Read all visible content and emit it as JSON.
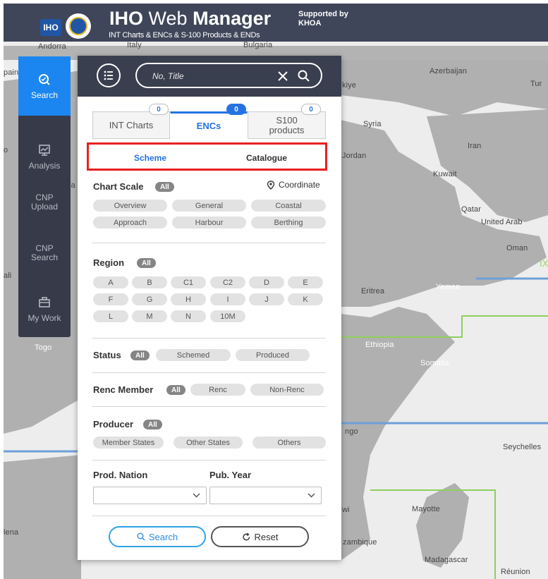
{
  "header": {
    "logo_text": "IHO",
    "title_bold": "IHO",
    "title_light": "Web",
    "title_bold2": "Manager",
    "subtitle": "INT Charts & ENCs & S-100 Products & ENDs",
    "supported_line1": "Supported by",
    "supported_line2": "KHOA"
  },
  "nav": {
    "items": [
      {
        "label": "Search",
        "icon": "search-icon",
        "active": true
      },
      {
        "label": "Analysis",
        "icon": "chart-icon",
        "active": false
      },
      {
        "label_line1": "CNP",
        "label_line2": "Upload"
      },
      {
        "label_line1": "CNP",
        "label_line2": "Search"
      },
      {
        "label": "My Work",
        "icon": "briefcase-icon",
        "active": false
      }
    ]
  },
  "search": {
    "placeholder": "No, Title",
    "value": ""
  },
  "tabs": [
    {
      "label": "INT Charts",
      "count": "0"
    },
    {
      "label": "ENCs",
      "count": "0",
      "active": true
    },
    {
      "label_line1": "S100",
      "label_line2": "products",
      "count": "0"
    }
  ],
  "subtabs": {
    "scheme": "Scheme",
    "catalogue": "Catalogue",
    "active": "Scheme"
  },
  "filters": {
    "chart_scale": {
      "title": "Chart Scale",
      "all": "All",
      "coordinate": "Coordinate",
      "options": [
        "Overview",
        "General",
        "Coastal",
        "Approach",
        "Harbour",
        "Berthing"
      ]
    },
    "region": {
      "title": "Region",
      "all": "All",
      "options": [
        "A",
        "B",
        "C1",
        "C2",
        "D",
        "E",
        "F",
        "G",
        "H",
        "I",
        "J",
        "K",
        "L",
        "M",
        "N",
        "10M"
      ]
    },
    "status": {
      "title": "Status",
      "all": "All",
      "options": [
        "Schemed",
        "Produced"
      ]
    },
    "renc_member": {
      "title": "Renc Member",
      "all": "All",
      "options": [
        "Renc",
        "Non-Renc"
      ]
    },
    "producer": {
      "title": "Producer",
      "all": "All",
      "options": [
        "Member States",
        "Other States",
        "Others"
      ]
    },
    "prod_nation": {
      "label": "Prod. Nation",
      "value": ""
    },
    "pub_year": {
      "label": "Pub. Year",
      "value": ""
    }
  },
  "buttons": {
    "search": "Search",
    "reset": "Reset"
  },
  "map_labels": {
    "andorra": "Andorra",
    "italy": "Italy",
    "bulgaria": "Bulgaria",
    "spain_partial": "pain",
    "azerbaijan": "Azerbaijan",
    "turkey_partial": "kiye",
    "turkmen_partial": "Tur",
    "syria": "Syria",
    "iran": "Iran",
    "jordan": "Jordan",
    "kuwait": "Kuwait",
    "qatar": "Qatar",
    "uae": "United Arab",
    "oman": "Oman",
    "region_ix": "IX",
    "mali_partial": "ali",
    "yemen": "Yemen",
    "eritrea": "Eritrea",
    "togo": "Togo",
    "ethiopia": "Ethiopia",
    "somalia": "Somalia",
    "congo_partial": "ngo",
    "seychelles": "Seychelles",
    "malawi_partial": "wi",
    "mayotte": "Mayotte",
    "helena_partial": "lena",
    "mozambique_partial": "zambique",
    "madagascar": "Madagascar",
    "reunion": "Réunion",
    "libya_partial": "ia",
    "morocco_partial": "o"
  },
  "colors": {
    "header_bg": "#3f4659",
    "nav_bg": "#363a49",
    "active_blue": "#1b86f0",
    "tab_blue": "#2573e3",
    "highlight_red": "#e8201f",
    "land": "#a9a9a9",
    "sea": "#ededed"
  }
}
